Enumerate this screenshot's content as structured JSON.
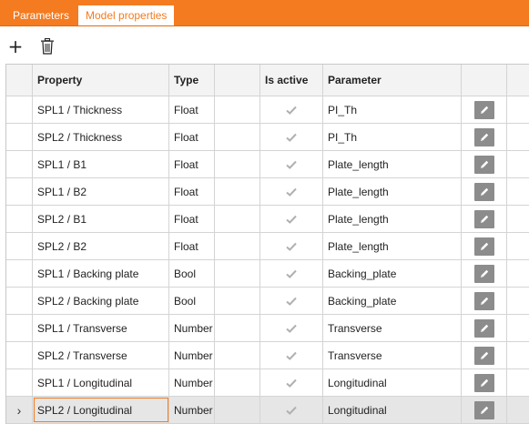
{
  "tabs": [
    {
      "label": "Parameters",
      "active": false
    },
    {
      "label": "Model properties",
      "active": true
    }
  ],
  "toolbar": {
    "add_icon": "plus-icon",
    "delete_icon": "trash-icon"
  },
  "columns": {
    "property": "Property",
    "type": "Type",
    "is_active": "Is active",
    "parameter": "Parameter"
  },
  "rows": [
    {
      "property": "SPL1 / Thickness",
      "type": "Float",
      "active": true,
      "parameter": "PI_Th"
    },
    {
      "property": "SPL2 / Thickness",
      "type": "Float",
      "active": true,
      "parameter": "PI_Th"
    },
    {
      "property": "SPL1 / B1",
      "type": "Float",
      "active": true,
      "parameter": "Plate_length"
    },
    {
      "property": "SPL1 / B2",
      "type": "Float",
      "active": true,
      "parameter": "Plate_length"
    },
    {
      "property": "SPL2 / B1",
      "type": "Float",
      "active": true,
      "parameter": "Plate_length"
    },
    {
      "property": "SPL2 / B2",
      "type": "Float",
      "active": true,
      "parameter": "Plate_length"
    },
    {
      "property": "SPL1 / Backing plate",
      "type": "Bool",
      "active": true,
      "parameter": "Backing_plate"
    },
    {
      "property": "SPL2 / Backing plate",
      "type": "Bool",
      "active": true,
      "parameter": "Backing_plate"
    },
    {
      "property": "SPL1 / Transverse",
      "type": "Number",
      "active": true,
      "parameter": "Transverse"
    },
    {
      "property": "SPL2 / Transverse",
      "type": "Number",
      "active": true,
      "parameter": "Transverse"
    },
    {
      "property": "SPL1 / Longitudinal",
      "type": "Number",
      "active": true,
      "parameter": "Longitudinal"
    },
    {
      "property": "SPL2 / Longitudinal",
      "type": "Number",
      "active": true,
      "parameter": "Longitudinal"
    }
  ],
  "selected_row_index": 11,
  "colors": {
    "accent": "#f47b20",
    "edit_button": "#8c8c8c",
    "checkmark": "#b0b0b0"
  }
}
